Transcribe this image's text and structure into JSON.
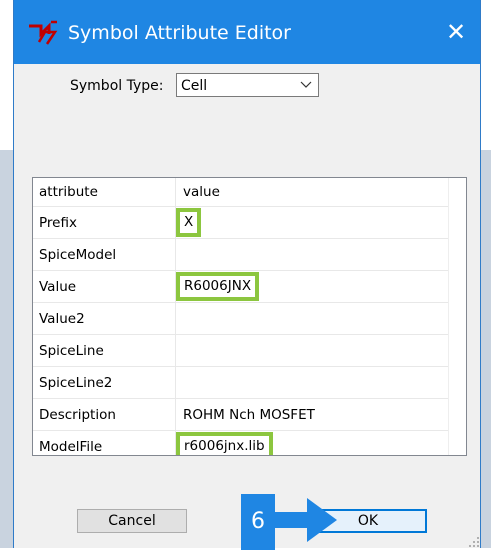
{
  "dialog": {
    "title": "Symbol Attribute Editor",
    "close_glyph": "✕",
    "icon": "schematic-symbol-icon"
  },
  "symbol_type": {
    "label": "Symbol Type:",
    "selected": "Cell"
  },
  "table": {
    "headers": [
      "attribute",
      "value"
    ],
    "rows": [
      {
        "attribute": "Prefix",
        "value": "X"
      },
      {
        "attribute": "SpiceModel",
        "value": ""
      },
      {
        "attribute": "Value",
        "value": "R6006JNX"
      },
      {
        "attribute": "Value2",
        "value": ""
      },
      {
        "attribute": "SpiceLine",
        "value": ""
      },
      {
        "attribute": "SpiceLine2",
        "value": ""
      },
      {
        "attribute": "Description",
        "value": "ROHM Nch MOSFET"
      },
      {
        "attribute": "ModelFile",
        "value": "r6006jnx.lib"
      }
    ]
  },
  "buttons": {
    "cancel": "Cancel",
    "ok": "OK"
  },
  "annotation": {
    "step_number": "6"
  },
  "colors": {
    "titlebar": "#1f86e3",
    "highlight_border": "#8cc63f",
    "annotation_arrow": "#1f86e3",
    "ok_focus_border": "#0078d7"
  }
}
